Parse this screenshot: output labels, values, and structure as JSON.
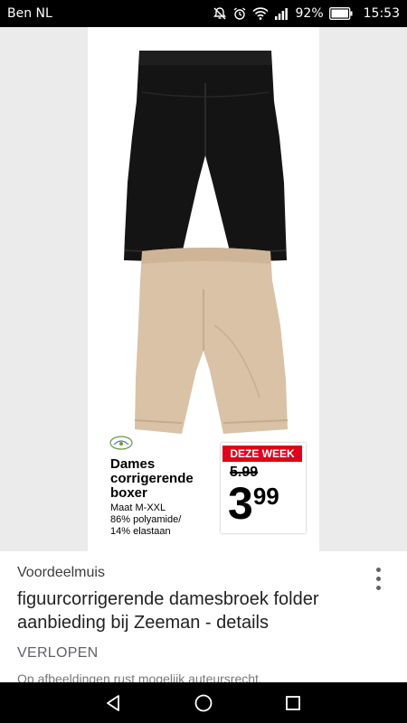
{
  "status_bar": {
    "carrier": "Ben NL",
    "battery": "92%",
    "time": "15:53"
  },
  "product": {
    "title": "Dames corrigerende boxer",
    "size": "Maat M-XXL",
    "material_1": "86% polyamide/",
    "material_2": "14% elastaan",
    "badge": "DEZE WEEK",
    "old_price": "5.99",
    "new_price_int": "3",
    "new_price_dec": "99",
    "badge_color": "#e2001a"
  },
  "details": {
    "source": "Voordeelmuis",
    "headline": "figuurcorrigerende damesbroek folder aanbieding bij Zeeman - details",
    "status": "VERLOPEN",
    "copyright": "Op afbeeldingen rust mogelijk auteursrecht."
  },
  "icons": {
    "more": "more-vertical-icon",
    "back": "back-icon",
    "home": "home-icon",
    "recent": "recent-apps-icon"
  }
}
